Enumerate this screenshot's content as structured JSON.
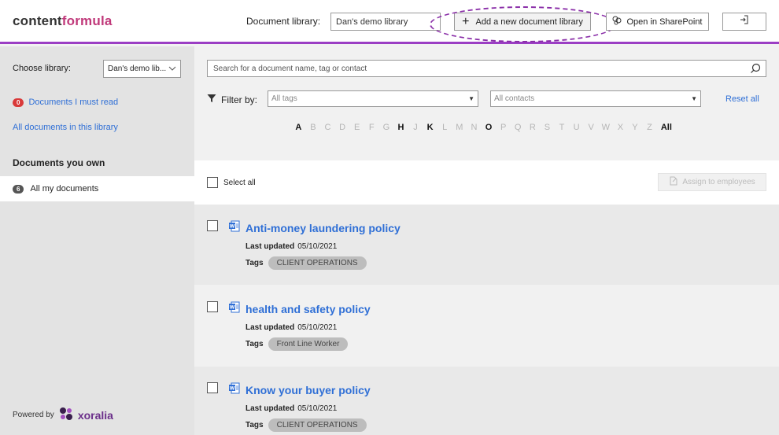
{
  "header": {
    "logo_part1": "content",
    "logo_part2": "formula",
    "doclib_label": "Document library:",
    "doclib_value": "Dan's demo library",
    "add_label": "Add a new document library",
    "sharepoint_label": "Open in SharePoint"
  },
  "sidebar": {
    "choose_label": "Choose library:",
    "choose_value": "Dan's demo lib...",
    "must_read_count": "0",
    "must_read_label": "Documents I must read",
    "all_docs_label": "All documents in this library",
    "own_title": "Documents you own",
    "my_docs_count": "6",
    "my_docs_label": "All my documents",
    "powered_label": "Powered by",
    "brand": "xoralia"
  },
  "filters": {
    "search_placeholder": "Search for a document name, tag or contact",
    "filter_label": "Filter by:",
    "tags_placeholder": "All tags",
    "contacts_placeholder": "All contacts",
    "reset_label": "Reset all",
    "letters": [
      "A",
      "B",
      "C",
      "D",
      "E",
      "F",
      "G",
      "H",
      "J",
      "K",
      "L",
      "M",
      "N",
      "O",
      "P",
      "Q",
      "R",
      "S",
      "T",
      "U",
      "V",
      "W",
      "X",
      "Y",
      "Z"
    ],
    "active_letters": [
      "A",
      "H",
      "K",
      "O"
    ],
    "all_label": "All"
  },
  "selectbar": {
    "select_all_label": "Select all",
    "assign_label": "Assign to employees"
  },
  "documents": [
    {
      "title": "Anti-money laundering policy",
      "updated_label": "Last updated",
      "updated": "05/10/2021",
      "tags_label": "Tags",
      "tag": "CLIENT OPERATIONS"
    },
    {
      "title": "health and safety policy",
      "updated_label": "Last updated",
      "updated": "05/10/2021",
      "tags_label": "Tags",
      "tag": "Front Line Worker"
    },
    {
      "title": "Know your buyer policy",
      "updated_label": "Last updated",
      "updated": "05/10/2021",
      "tags_label": "Tags",
      "tag": "CLIENT OPERATIONS"
    }
  ],
  "colors": {
    "accent": "#9b3ec4",
    "link": "#2f6fd6",
    "brand_pink": "#c0397a",
    "badge_red": "#d93a3a"
  }
}
